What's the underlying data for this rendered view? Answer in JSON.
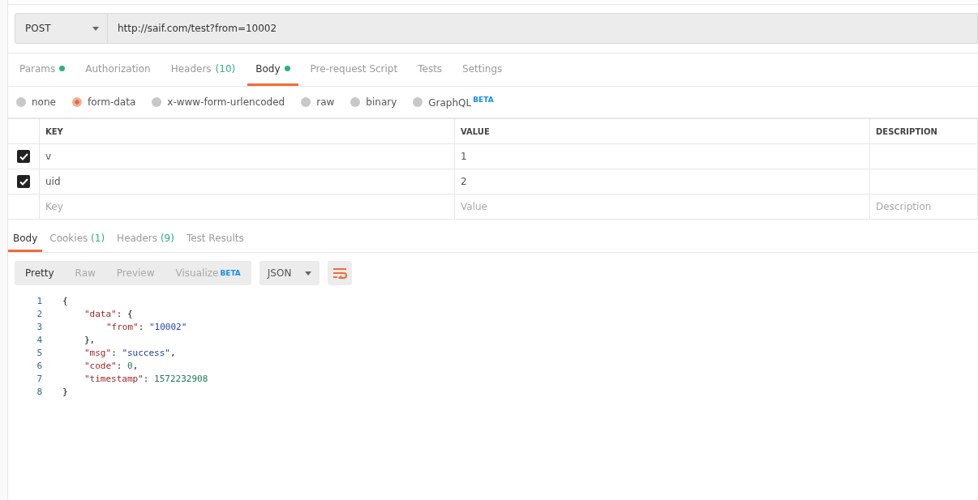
{
  "request": {
    "method": "POST",
    "url": "http://saif.com/test?from=10002"
  },
  "request_tabs": [
    {
      "label": "Params",
      "dot": true,
      "selected": false
    },
    {
      "label": "Authorization",
      "selected": false
    },
    {
      "label": "Headers",
      "count": "(10)",
      "selected": false
    },
    {
      "label": "Body",
      "dot": true,
      "selected": true
    },
    {
      "label": "Pre-request Script",
      "selected": false
    },
    {
      "label": "Tests",
      "selected": false
    },
    {
      "label": "Settings",
      "selected": false
    }
  ],
  "body_types": [
    {
      "label": "none",
      "selected": false
    },
    {
      "label": "form-data",
      "selected": true
    },
    {
      "label": "x-www-form-urlencoded",
      "selected": false
    },
    {
      "label": "raw",
      "selected": false
    },
    {
      "label": "binary",
      "selected": false
    },
    {
      "label": "GraphQL",
      "badge": "BETA",
      "selected": false
    }
  ],
  "params_table": {
    "columns": [
      "KEY",
      "VALUE",
      "DESCRIPTION"
    ],
    "rows": [
      {
        "checked": true,
        "key": "v",
        "value": "1"
      },
      {
        "checked": true,
        "key": "uid",
        "value": "2"
      }
    ],
    "new_row": {
      "key_placeholder": "Key",
      "value_placeholder": "Value",
      "description_placeholder": "Description"
    }
  },
  "response_tabs": [
    {
      "label": "Body",
      "selected": true
    },
    {
      "label": "Cookies",
      "count": "(1)",
      "selected": false
    },
    {
      "label": "Headers",
      "count": "(9)",
      "selected": false
    },
    {
      "label": "Test Results",
      "selected": false
    }
  ],
  "view_modes": [
    {
      "label": "Pretty",
      "selected": true
    },
    {
      "label": "Raw",
      "selected": false
    },
    {
      "label": "Preview",
      "selected": false
    },
    {
      "label": "Visualize",
      "badge": "BETA",
      "selected": false
    }
  ],
  "format": "JSON",
  "code": [
    {
      "number": "1",
      "tokens": [
        {
          "kind": "punct",
          "text": "{"
        }
      ],
      "children": [
        {
          "number": "2",
          "tokens": [
            {
              "kind": "key",
              "text": "\"data\""
            },
            {
              "kind": "punct",
              "text": ": {"
            }
          ],
          "children": [
            {
              "number": "3",
              "tokens": [
                {
                  "kind": "key",
                  "text": "\"from\""
                },
                {
                  "kind": "punct",
                  "text": ": "
                },
                {
                  "kind": "string",
                  "text": "\"10002\""
                }
              ]
            }
          ]
        },
        {
          "number": "4",
          "tokens": [
            {
              "kind": "punct",
              "text": "},"
            }
          ]
        },
        {
          "number": "5",
          "tokens": [
            {
              "kind": "key",
              "text": "\"msg\""
            },
            {
              "kind": "punct",
              "text": ": "
            },
            {
              "kind": "string",
              "text": "\"success\""
            },
            {
              "kind": "punct",
              "text": ","
            }
          ]
        },
        {
          "number": "6",
          "tokens": [
            {
              "kind": "key",
              "text": "\"code\""
            },
            {
              "kind": "punct",
              "text": ": "
            },
            {
              "kind": "number",
              "text": "0"
            },
            {
              "kind": "punct",
              "text": ","
            }
          ]
        },
        {
          "number": "7",
          "tokens": [
            {
              "kind": "key",
              "text": "\"timestamp\""
            },
            {
              "kind": "punct",
              "text": ": "
            },
            {
              "kind": "number",
              "text": "1572232908"
            }
          ]
        }
      ]
    },
    {
      "number": "8",
      "tokens": [
        {
          "kind": "punct",
          "text": "}"
        }
      ]
    }
  ]
}
